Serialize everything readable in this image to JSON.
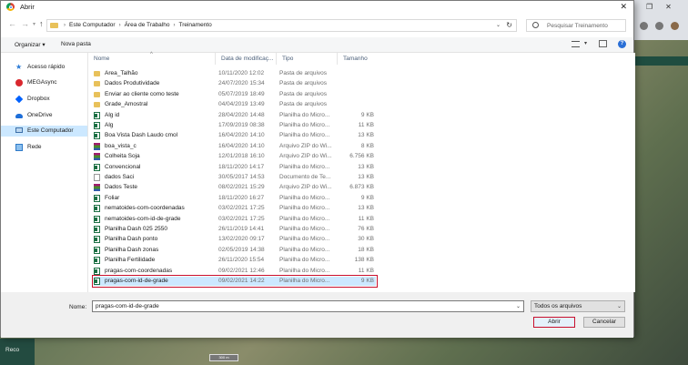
{
  "dialog": {
    "title": "Abrir",
    "breadcrumbs": [
      "Este Computador",
      "Área de Trabalho",
      "Treinamento"
    ],
    "search_placeholder": "Pesquisar Treinamento",
    "toolbar": {
      "organize": "Organizar",
      "new_folder": "Nova pasta"
    },
    "sidebar": [
      {
        "label": "Acesso rápido",
        "icon": "star-icon"
      },
      {
        "label": "MEGAsync",
        "icon": "megasync-icon"
      },
      {
        "label": "Dropbox",
        "icon": "dropbox-icon"
      },
      {
        "label": "OneDrive",
        "icon": "onedrive-icon"
      },
      {
        "label": "Este Computador",
        "icon": "computer-icon",
        "selected": true
      },
      {
        "label": "Rede",
        "icon": "network-icon"
      }
    ],
    "columns": [
      "Nome",
      "Data de modificaç...",
      "Tipo",
      "Tamanho"
    ],
    "files": [
      {
        "name": "Area_Talhão",
        "date": "10/11/2020 12:02",
        "type": "Pasta de arquivos",
        "size": "",
        "kind": "folder"
      },
      {
        "name": "Dados Produtividade",
        "date": "24/07/2020 15:34",
        "type": "Pasta de arquivos",
        "size": "",
        "kind": "folder"
      },
      {
        "name": "Enviar ao cliente como teste",
        "date": "05/07/2019 18:49",
        "type": "Pasta de arquivos",
        "size": "",
        "kind": "folder"
      },
      {
        "name": "Grade_Amostral",
        "date": "04/04/2019 13:49",
        "type": "Pasta de arquivos",
        "size": "",
        "kind": "folder"
      },
      {
        "name": "Alg id",
        "date": "28/04/2020 14:48",
        "type": "Planilha do Micro...",
        "size": "9 KB",
        "kind": "excel"
      },
      {
        "name": "Alg",
        "date": "17/09/2019 08:38",
        "type": "Planilha do Micro...",
        "size": "11 KB",
        "kind": "excel"
      },
      {
        "name": "Boa Vista Dash Laudo cmol",
        "date": "16/04/2020 14:10",
        "type": "Planilha do Micro...",
        "size": "13 KB",
        "kind": "excel"
      },
      {
        "name": "boa_vista_c",
        "date": "16/04/2020 14:10",
        "type": "Arquivo ZIP do Wi...",
        "size": "8 KB",
        "kind": "zip"
      },
      {
        "name": "Colheita Soja",
        "date": "12/01/2018 16:10",
        "type": "Arquivo ZIP do Wi...",
        "size": "6.756 KB",
        "kind": "zip"
      },
      {
        "name": "Convencional",
        "date": "18/11/2020 14:17",
        "type": "Planilha do Micro...",
        "size": "13 KB",
        "kind": "excel"
      },
      {
        "name": "dados Saci",
        "date": "30/05/2017 14:53",
        "type": "Documento de Te...",
        "size": "13 KB",
        "kind": "doc"
      },
      {
        "name": "Dados Teste",
        "date": "08/02/2021 15:29",
        "type": "Arquivo ZIP do Wi...",
        "size": "6.873 KB",
        "kind": "zip"
      },
      {
        "name": "Foliar",
        "date": "18/11/2020 16:27",
        "type": "Planilha do Micro...",
        "size": "9 KB",
        "kind": "excel"
      },
      {
        "name": "nematoides-com-coordenadas",
        "date": "03/02/2021 17:25",
        "type": "Planilha do Micro...",
        "size": "13 KB",
        "kind": "excel"
      },
      {
        "name": "nematoides-com-id-de-grade",
        "date": "03/02/2021 17:25",
        "type": "Planilha do Micro...",
        "size": "11 KB",
        "kind": "excel"
      },
      {
        "name": "Planilha Dash 025 2550",
        "date": "26/11/2019 14:41",
        "type": "Planilha do Micro...",
        "size": "76 KB",
        "kind": "excel"
      },
      {
        "name": "Planilha Dash ponto",
        "date": "13/02/2020 09:17",
        "type": "Planilha do Micro...",
        "size": "30 KB",
        "kind": "excel"
      },
      {
        "name": "Planilha Dash zonas",
        "date": "02/05/2019 14:38",
        "type": "Planilha do Micro...",
        "size": "18 KB",
        "kind": "excel"
      },
      {
        "name": "Planilha Fertilidade",
        "date": "26/11/2020 15:54",
        "type": "Planilha do Micro...",
        "size": "138 KB",
        "kind": "excel"
      },
      {
        "name": "pragas-com-coordenadas",
        "date": "09/02/2021 12:46",
        "type": "Planilha do Micro...",
        "size": "11 KB",
        "kind": "excel"
      },
      {
        "name": "pragas-com-id-de-grade",
        "date": "09/02/2021 14:22",
        "type": "Planilha do Micro...",
        "size": "9 KB",
        "kind": "excel",
        "selected": true
      }
    ],
    "filename_label": "Nome:",
    "filename_value": "pragas-com-id-de-grade",
    "filter_value": "Todos os arquivos",
    "open_label": "Abrir",
    "cancel_label": "Cancelar"
  },
  "background": {
    "reco_label": "Reco",
    "scale_label": "300 m"
  }
}
